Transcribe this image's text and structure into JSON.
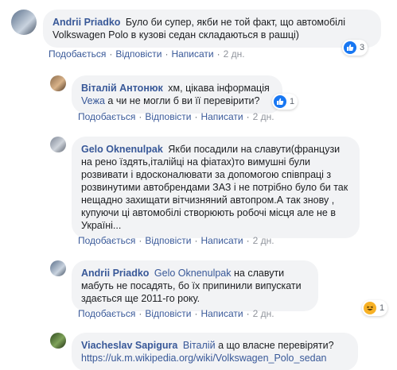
{
  "comments": [
    {
      "author": "Andrii Priadko",
      "text": "Було би супер, якби не той факт, що автомобілі Volkswagen Polo в кузові седан складаються в рашці)",
      "actions": {
        "like": "Подобається",
        "reply": "Відповісти",
        "write": "Написати",
        "time": "2 дн."
      },
      "reaction": {
        "icon": "like-icon",
        "count": "3"
      }
    },
    {
      "author": "Віталій Антонюк",
      "text": "хм, цікава інформація",
      "mention": "Veжа",
      "text2": "а чи не могли б ви її перевірити?",
      "actions": {
        "like": "Подобається",
        "reply": "Відповісти",
        "write": "Написати",
        "time": "2 дн."
      },
      "reaction": {
        "icon": "like-icon",
        "count": "1"
      }
    },
    {
      "author": "Gelo Oknenulpak",
      "text": "Якби посадили на славути(французи на рено їздять,італійці на фіатах)то вимушні були розвивати і вдосконалювати за допомогою співпраці з розвинутими автобрендами ЗАЗ і не потрібно було би так нещадно захищати вітчизняний автопром.А так знову , купуючи ці автомобілі створюють робочі місця але не в Україні...",
      "actions": {
        "like": "Подобається",
        "reply": "Відповісти",
        "write": "Написати",
        "time": "2 дн."
      }
    },
    {
      "author": "Andrii Priadko",
      "mention": "Gelo Oknenulpak",
      "text": "на славути мабуть не посадять, бо їх припинили випускати здається ще 2011-го року.",
      "actions": {
        "like": "Подобається",
        "reply": "Відповісти",
        "write": "Написати",
        "time": "2 дн."
      },
      "reaction": {
        "icon": "haha-icon",
        "count": "1"
      }
    },
    {
      "author": "Viacheslav Sapigura",
      "mention": "Віталій",
      "text": "а що власне перевіряти?",
      "link": "https://uk.m.wikipedia.org/wiki/Volkswagen_Polo_sedan"
    }
  ],
  "colors": {
    "link": "#385898",
    "bubble": "#f2f3f5",
    "meta": "#606770",
    "like": "#1877f2",
    "haha": "#f7b125"
  }
}
